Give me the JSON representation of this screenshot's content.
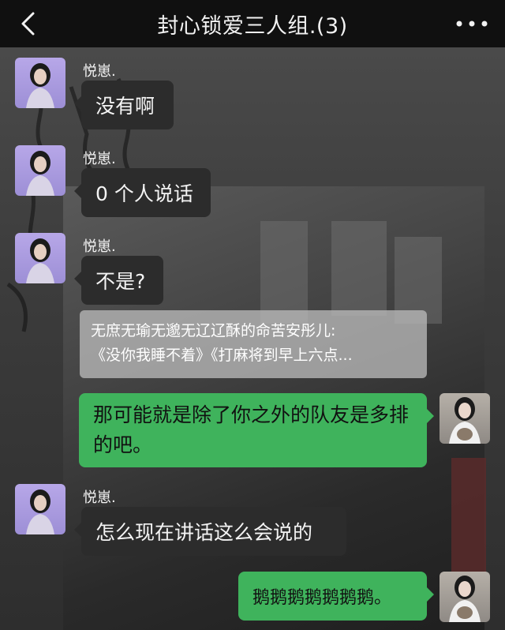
{
  "header": {
    "title": "封心锁爱三人组.(3)",
    "back_icon": "chevron-left-icon",
    "more_icon": "more-dots-icon"
  },
  "messages": [
    {
      "sender": "悦崽.",
      "text": "没有啊",
      "direction": "in"
    },
    {
      "sender": "悦崽.",
      "text": "0 个人说话",
      "direction": "in"
    },
    {
      "sender": "悦崽.",
      "text": "不是?",
      "direction": "in"
    },
    {
      "quote_line1": "无庶无瑜无邈无辽辽酥的命苦安彤儿:",
      "quote_line2": "《没你我睡不着》《打麻将到早上六点..."
    },
    {
      "text": "那可能就是除了你之外的队友是多排的吧。",
      "direction": "out"
    },
    {
      "sender": "悦崽.",
      "text": "怎么现在讲话这么会说的",
      "direction": "in"
    },
    {
      "text": "鹅鹅鹅鹅鹅鹅鹅。",
      "direction": "out"
    }
  ],
  "colors": {
    "header_bg": "#101010",
    "outgoing_bubble": "#3fb35c",
    "incoming_bubble": "#2c2c2c"
  }
}
